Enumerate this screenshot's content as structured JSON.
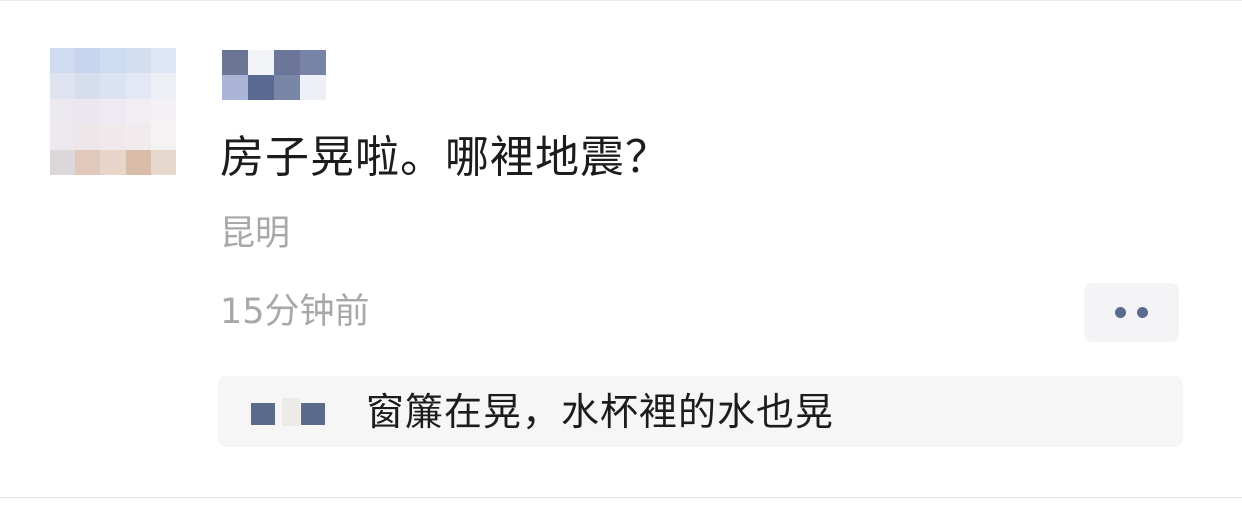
{
  "post": {
    "text": "房子晃啦。哪裡地震？",
    "location": "昆明",
    "time": "15分钟前"
  },
  "comment": {
    "text": "窗簾在晃，水杯裡的水也晃"
  },
  "icons": {
    "more": "more-dots-icon"
  },
  "colors": {
    "text_primary": "#1c1c1c",
    "text_secondary": "#a8a8a8",
    "accent_blue": "#5a6b8e",
    "comment_bg": "#f6f6f6"
  }
}
